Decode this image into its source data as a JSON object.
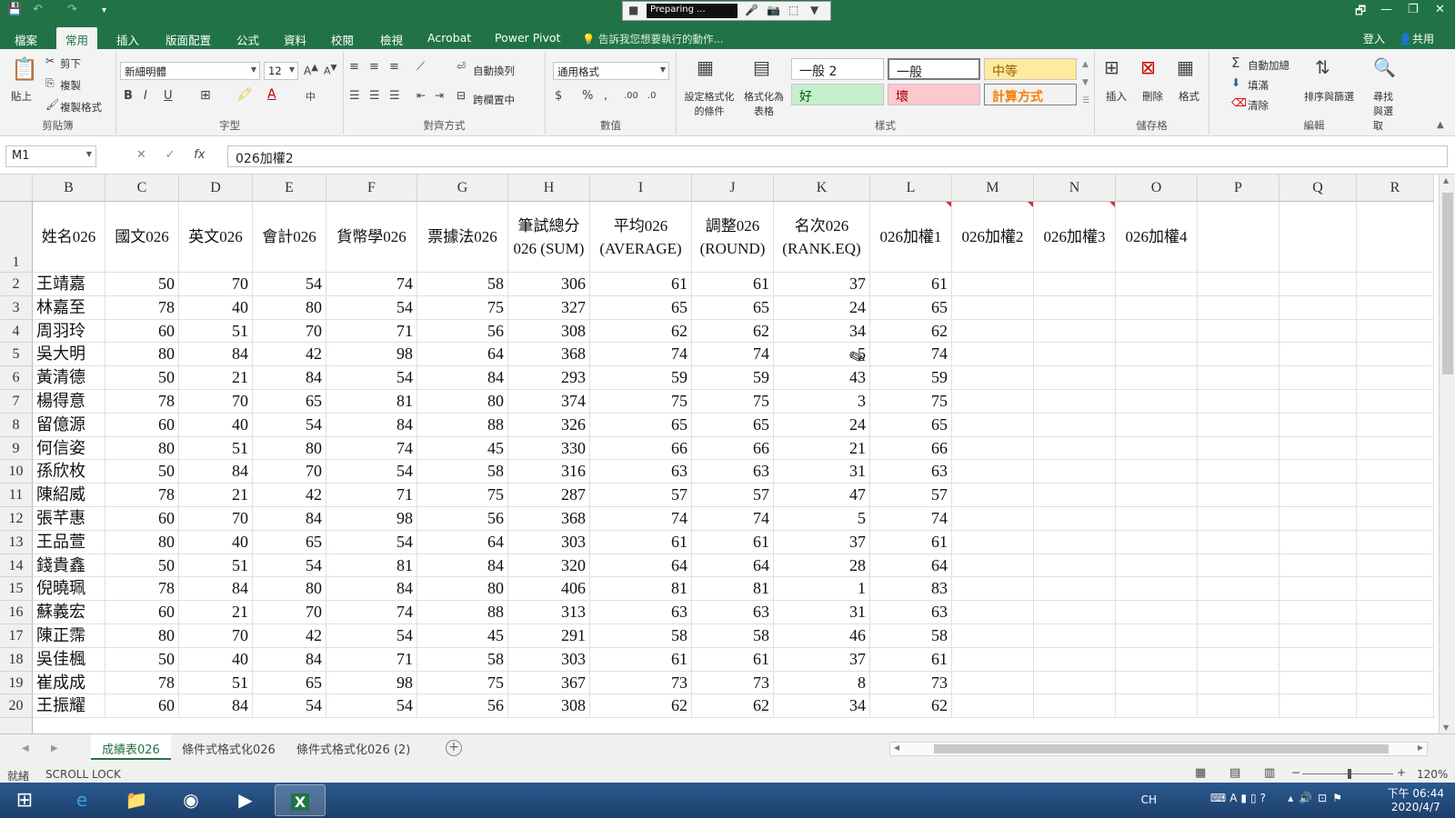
{
  "titlebar": {
    "recorder_status": "Preparing ...",
    "window_buttons": [
      "🗗",
      "—",
      "❐",
      "✕"
    ]
  },
  "tabs": [
    "檔案",
    "常用",
    "插入",
    "版面配置",
    "公式",
    "資料",
    "校閱",
    "檢視",
    "Acrobat",
    "Power Pivot"
  ],
  "tell_me": "告訴我您想要執行的動作...",
  "sign_in": "登入",
  "share": "共用",
  "ribbon": {
    "clipboard": {
      "name": "剪貼簿",
      "paste": "貼上",
      "cut": "剪下",
      "copy": "複製",
      "format_painter": "複製格式"
    },
    "font": {
      "name": "字型",
      "font_name": "新細明體",
      "font_size": "12"
    },
    "alignment": {
      "name": "對齊方式",
      "wrap": "自動換列",
      "merge": "跨欄置中"
    },
    "number": {
      "name": "數值",
      "format": "通用格式"
    },
    "styles": {
      "name": "樣式",
      "cond_format": "設定格式化的條件",
      "format_table": "格式化為表格",
      "cells": [
        "一般 2",
        "一般",
        "中等",
        "好",
        "壞",
        "計算方式"
      ]
    },
    "cells_group": {
      "name": "儲存格",
      "insert": "插入",
      "delete": "刪除",
      "format": "格式"
    },
    "editing": {
      "name": "編輯",
      "autosum": "自動加總",
      "fill": "填滿",
      "clear": "清除",
      "sort": "排序與篩選",
      "find": "尋找與選取"
    }
  },
  "formula_bar": {
    "name_box": "M1",
    "formula": "026加權2"
  },
  "columns": [
    "B",
    "C",
    "D",
    "E",
    "F",
    "G",
    "H",
    "I",
    "J",
    "K",
    "L",
    "M",
    "N",
    "O",
    "P",
    "Q",
    "R"
  ],
  "header_row": [
    "姓名026",
    "國文026",
    "英文026",
    "會計026",
    "貨幣學026",
    "票據法026",
    "筆試總分 026 (SUM)",
    "平均026 (AVERAGE)",
    "調整026 (ROUND)",
    "名次026 (RANK.EQ)",
    "026加權1",
    "026加權2",
    "026加權3",
    "026加權4",
    "",
    "",
    ""
  ],
  "rows": [
    {
      "n": "2",
      "cells": [
        "王靖嘉",
        "50",
        "70",
        "54",
        "74",
        "58",
        "306",
        "61",
        "61",
        "37",
        "61"
      ]
    },
    {
      "n": "3",
      "cells": [
        "林嘉至",
        "78",
        "40",
        "80",
        "54",
        "75",
        "327",
        "65",
        "65",
        "24",
        "65"
      ]
    },
    {
      "n": "4",
      "cells": [
        "周羽玲",
        "60",
        "51",
        "70",
        "71",
        "56",
        "308",
        "62",
        "62",
        "34",
        "62"
      ]
    },
    {
      "n": "5",
      "cells": [
        "吳大明",
        "80",
        "84",
        "42",
        "98",
        "64",
        "368",
        "74",
        "74",
        "5",
        "74"
      ]
    },
    {
      "n": "6",
      "cells": [
        "黃清德",
        "50",
        "21",
        "84",
        "54",
        "84",
        "293",
        "59",
        "59",
        "43",
        "59"
      ]
    },
    {
      "n": "7",
      "cells": [
        "楊得意",
        "78",
        "70",
        "65",
        "81",
        "80",
        "374",
        "75",
        "75",
        "3",
        "75"
      ]
    },
    {
      "n": "8",
      "cells": [
        "留億源",
        "60",
        "40",
        "54",
        "84",
        "88",
        "326",
        "65",
        "65",
        "24",
        "65"
      ]
    },
    {
      "n": "9",
      "cells": [
        "何信姿",
        "80",
        "51",
        "80",
        "74",
        "45",
        "330",
        "66",
        "66",
        "21",
        "66"
      ]
    },
    {
      "n": "10",
      "cells": [
        "孫欣枚",
        "50",
        "84",
        "70",
        "54",
        "58",
        "316",
        "63",
        "63",
        "31",
        "63"
      ]
    },
    {
      "n": "11",
      "cells": [
        "陳紹威",
        "78",
        "21",
        "42",
        "71",
        "75",
        "287",
        "57",
        "57",
        "47",
        "57"
      ]
    },
    {
      "n": "12",
      "cells": [
        "張芊惠",
        "60",
        "70",
        "84",
        "98",
        "56",
        "368",
        "74",
        "74",
        "5",
        "74"
      ]
    },
    {
      "n": "13",
      "cells": [
        "王品萱",
        "80",
        "40",
        "65",
        "54",
        "64",
        "303",
        "61",
        "61",
        "37",
        "61"
      ]
    },
    {
      "n": "14",
      "cells": [
        "錢貴鑫",
        "50",
        "51",
        "54",
        "81",
        "84",
        "320",
        "64",
        "64",
        "28",
        "64"
      ]
    },
    {
      "n": "15",
      "cells": [
        "倪曉珮",
        "78",
        "84",
        "80",
        "84",
        "80",
        "406",
        "81",
        "81",
        "1",
        "83"
      ]
    },
    {
      "n": "16",
      "cells": [
        "蘇義宏",
        "60",
        "21",
        "70",
        "74",
        "88",
        "313",
        "63",
        "63",
        "31",
        "63"
      ]
    },
    {
      "n": "17",
      "cells": [
        "陳正霈",
        "80",
        "70",
        "42",
        "54",
        "45",
        "291",
        "58",
        "58",
        "46",
        "58"
      ]
    },
    {
      "n": "18",
      "cells": [
        "吳佳楓",
        "50",
        "40",
        "84",
        "71",
        "58",
        "303",
        "61",
        "61",
        "37",
        "61"
      ]
    },
    {
      "n": "19",
      "cells": [
        "崔成成",
        "78",
        "51",
        "65",
        "98",
        "75",
        "367",
        "73",
        "73",
        "8",
        "73"
      ]
    },
    {
      "n": "20",
      "cells": [
        "王振耀",
        "60",
        "84",
        "54",
        "54",
        "56",
        "308",
        "62",
        "62",
        "34",
        "62"
      ]
    }
  ],
  "sheets": [
    "成績表026",
    "條件式格式化026",
    "條件式格式化026 (2)"
  ],
  "status": {
    "ready": "就緒",
    "scroll_lock": "SCROLL LOCK",
    "zoom": "120%"
  },
  "tray": {
    "lang": "CH",
    "time": "下午 06:44",
    "date": "2020/4/7"
  },
  "colors": {
    "excel_green": "#217346",
    "good_bg": "#c6efce",
    "bad_bg": "#ffc7ce",
    "neutral_bg": "#ffeb9c",
    "calc_bg": "#f2f2f2"
  }
}
